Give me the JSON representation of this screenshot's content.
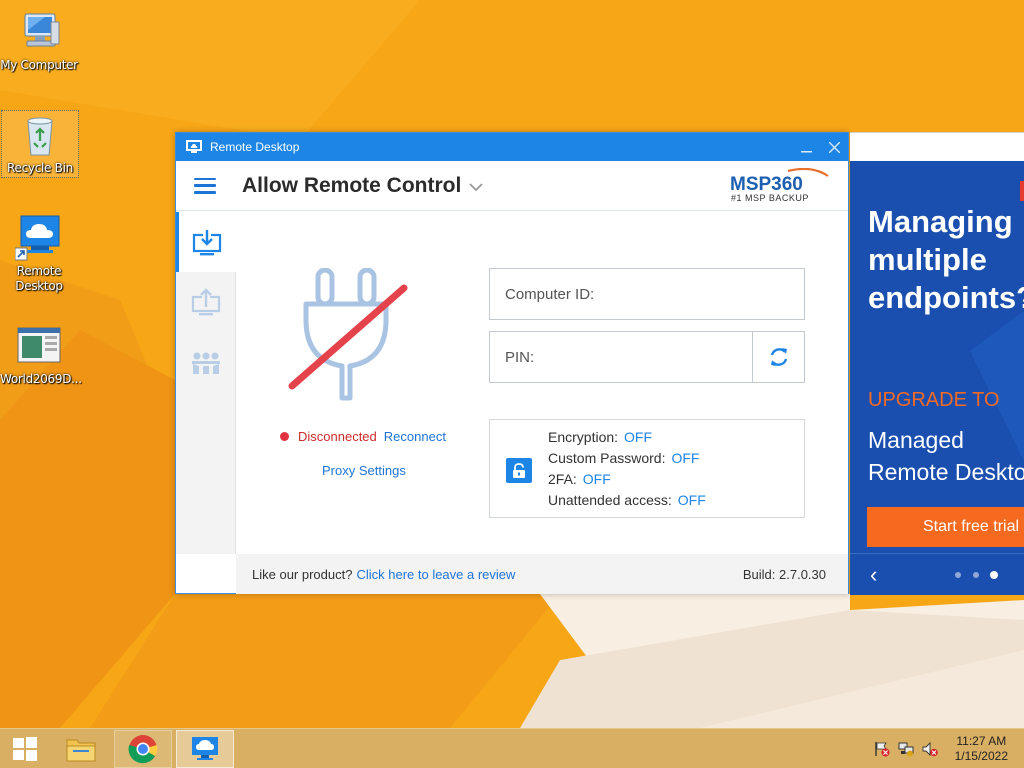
{
  "desktop": {
    "icons": [
      {
        "label": "My Computer"
      },
      {
        "label": "Recycle Bin"
      },
      {
        "label": "Remote Desktop"
      },
      {
        "label": "World2069D..."
      }
    ]
  },
  "window": {
    "title": "Remote Desktop",
    "mode_title": "Allow Remote Control",
    "logo_brand": "MSP360",
    "logo_tagline": "#1 MSP BACKUP",
    "sidebar": [
      "download-icon",
      "upload-icon",
      "users-icon"
    ],
    "status": {
      "text": "Disconnected",
      "action": "Reconnect"
    },
    "proxy_label": "Proxy Settings",
    "computer_id_placeholder": "Computer ID:",
    "pin_placeholder": "PIN:",
    "security": {
      "encryption_label": "Encryption:",
      "encryption_value": "OFF",
      "password_label": "Custom Password:",
      "password_value": "OFF",
      "twofa_label": "2FA:",
      "twofa_value": "OFF",
      "unattended_label": "Unattended access:",
      "unattended_value": "OFF"
    },
    "footer": {
      "prompt": "Like our product?",
      "review_link": "Click here to leave a review",
      "build": "Build: 2.7.0.30"
    }
  },
  "ad": {
    "headline_1": "Managing",
    "headline_2": "multiple",
    "headline_3": "endpoints?",
    "upgrade": "UPGRADE TO",
    "product_1": "Managed",
    "product_2": "Remote Desktop",
    "cta": "Start free trial",
    "active_slide": 3,
    "slide_count": 3
  },
  "taskbar": {
    "clock_time": "11:27 AM",
    "clock_date": "1/15/2022"
  },
  "colors": {
    "accent": "#1d85e6",
    "status_red": "#cf2a2a",
    "ad_blue": "#1a4fb0",
    "ad_orange": "#f56a1f",
    "wallpaper": "#f6a317"
  }
}
